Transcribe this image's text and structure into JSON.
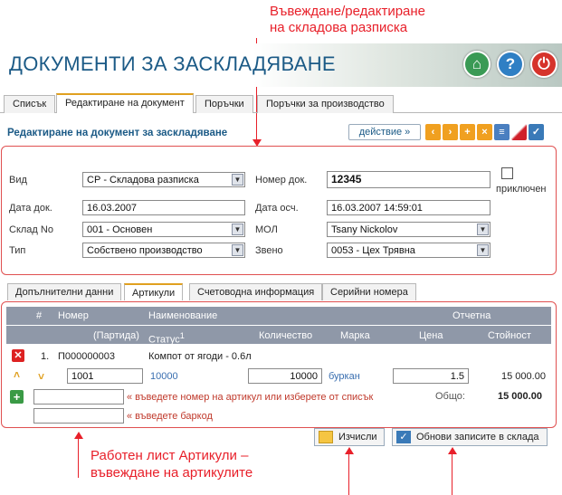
{
  "annotations": {
    "top_line1": "Въвеждане/редактиране",
    "top_line2": "на складова разписка",
    "bottom_line1": "Работен лист Артикули –",
    "bottom_line2": "въвеждане на артикулите"
  },
  "header": {
    "title": "ДОКУМЕНТИ ЗА ЗАСКЛАДЯВАНЕ",
    "home_icon": "home-icon",
    "help_icon": "help-icon",
    "power_icon": "power-icon"
  },
  "tabs": [
    "Списък",
    "Редактиране на документ",
    "Поръчки",
    "Поръчки за производство"
  ],
  "subtitle": "Редактиране на документ за заскладяване",
  "toolbar": {
    "action_label": "действие »",
    "buttons": [
      "‹",
      "›",
      "+",
      "×",
      "≡",
      "",
      "✓"
    ]
  },
  "form": {
    "vid_label": "Вид",
    "vid_value": "СР - Складова разписка",
    "nomer_label": "Номер док.",
    "nomer_value": "12345",
    "closed_label": "приключен",
    "date_label": "Дата док.",
    "date_value": "16.03.2007",
    "date_osch_label": "Дата осч.",
    "date_osch_value": "16.03.2007 14:59:01",
    "sklad_label": "Склад No",
    "sklad_value": "001 - Основен",
    "mol_label": "МОЛ",
    "mol_value": "Tsany Nickolov",
    "tip_label": "Тип",
    "tip_value": "Собствено производство",
    "zveno_label": "Звено",
    "zveno_value": "0053 - Цех Трявна"
  },
  "tabs2": [
    "Допълнителни данни",
    "Артикули",
    "Счетоводна информация",
    "Серийни номера"
  ],
  "grid": {
    "h_hash": "#",
    "h_nomer": "Номер",
    "h_naim": "Наименование",
    "h_otchetna": "Отчетна",
    "h_partida": "(Партида)",
    "h_status": "Статус",
    "h_status_sup": "1",
    "h_kolichestvo": "Количество",
    "h_marka": "Марка",
    "h_cena": "Цена",
    "h_stoinost": "Стойност",
    "row_num": "1.",
    "row_code": "П000000003",
    "row_name": "Компот от ягоди - 0.6л",
    "row_partida": "1001",
    "row_status": "10000",
    "row_qty": "10000",
    "row_marka": "буркан",
    "row_price": "1.5",
    "row_value": "15 000.00",
    "hint_article": "« въведете номер на артикул или изберете от списък",
    "hint_barcode": "« въведете баркод",
    "total_label": "Общо:",
    "total_value": "15 000.00"
  },
  "buttons": {
    "calc": "Изчисли",
    "update": "Обнови записите в склада"
  }
}
